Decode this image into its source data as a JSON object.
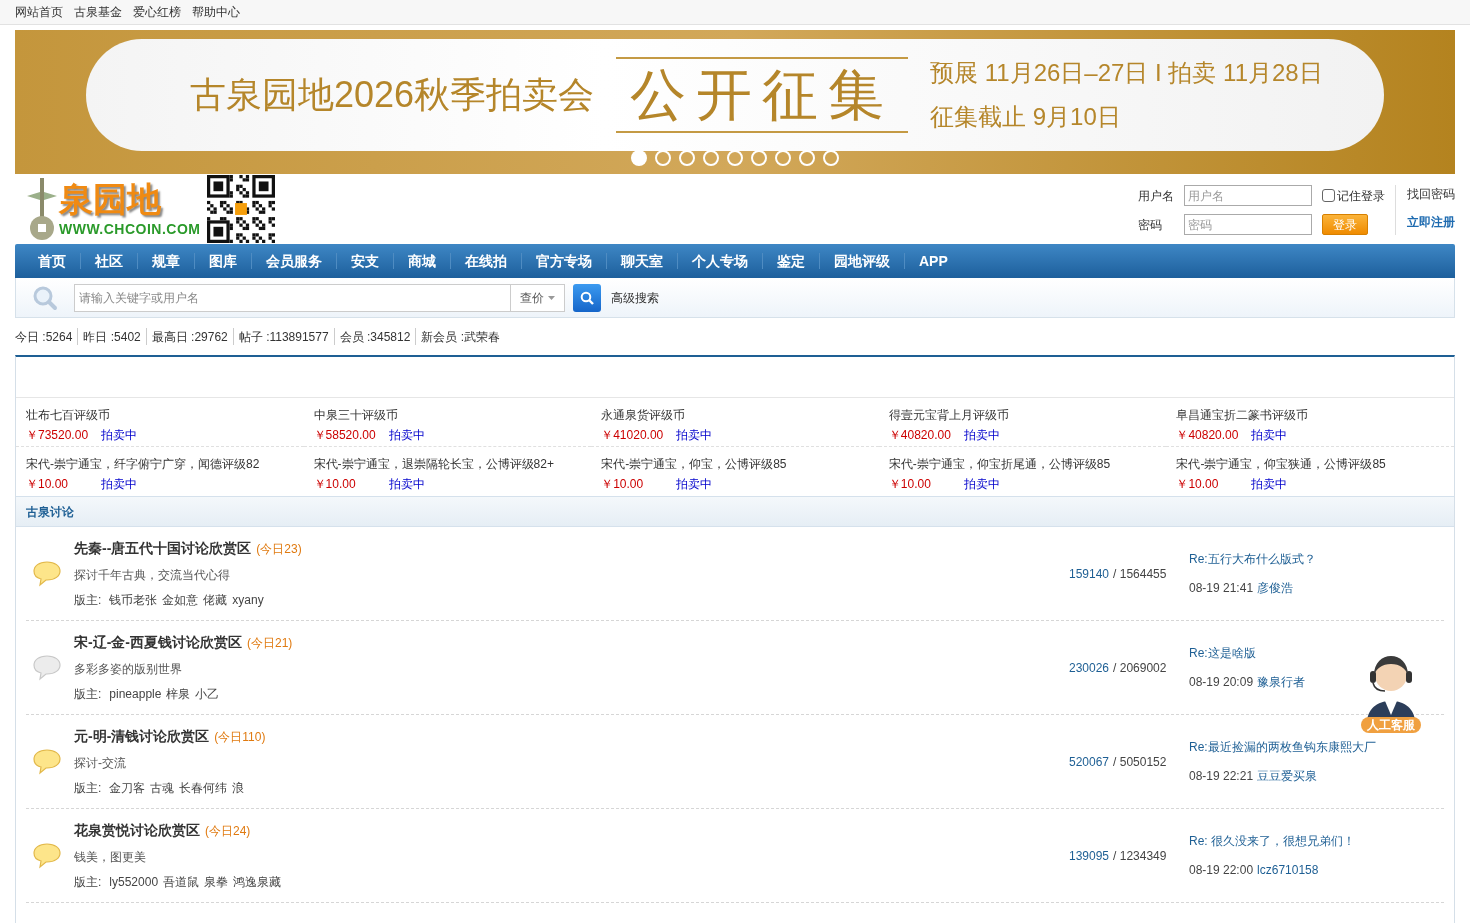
{
  "top_links": [
    "网站首页",
    "古泉基金",
    "爱心红榜",
    "帮助中心"
  ],
  "banner": {
    "title": "古泉园地2026秋季拍卖会",
    "headline": "公开征集",
    "schedule": "预展 11月26日–27日 I 拍卖 11月28日",
    "deadline": "征集截止 9月10日",
    "slides": [
      {
        "selected": true
      },
      {
        "selected": false
      },
      {
        "selected": false
      },
      {
        "selected": false
      },
      {
        "selected": false
      },
      {
        "selected": false
      },
      {
        "selected": false
      },
      {
        "selected": false
      },
      {
        "selected": false
      }
    ]
  },
  "logo": {
    "name": "泉园地",
    "url": "WWW.CHCOIN.COM"
  },
  "login": {
    "username_label": "用户名",
    "username_placeholder": "用户名",
    "remember_label": "记住登录",
    "remember": false,
    "password_label": "密码",
    "password_placeholder": "密码",
    "login_button": "登录",
    "forgot": "找回密码",
    "register": "立即注册"
  },
  "nav": [
    "首页",
    "社区",
    "规章",
    "图库",
    "会员服务",
    "安支",
    "商城",
    "在线拍",
    "官方专场",
    "聊天室",
    "个人专场",
    "鉴定",
    "园地评级",
    "APP"
  ],
  "search": {
    "placeholder": "请输入关键字或用户名",
    "type": "查价",
    "advanced": "高级搜索"
  },
  "stats": [
    "今日 :5264",
    "昨日 :5402",
    "最高日 :29762",
    "帖子 :113891577",
    "会员 :345812",
    "新会员 :武荣春"
  ],
  "auctions": [
    {
      "name": "壮布七百评级币",
      "price": "￥73520.00",
      "status": "拍卖中"
    },
    {
      "name": "中泉三十评级币",
      "price": "￥58520.00",
      "status": "拍卖中"
    },
    {
      "name": "永通泉货评级币",
      "price": "￥41020.00",
      "status": "拍卖中"
    },
    {
      "name": "得壹元宝背上月评级币",
      "price": "￥40820.00",
      "status": "拍卖中"
    },
    {
      "name": "阜昌通宝折二篆书评级币",
      "price": "￥40820.00",
      "status": "拍卖中"
    },
    {
      "name": "宋代-崇宁通宝，纤字俯宁广穿，闻德评级82",
      "price": "￥10.00",
      "status": "拍卖中"
    },
    {
      "name": "宋代-崇宁通宝，退崇隔轮长宝，公博评级82+",
      "price": "￥10.00",
      "status": "拍卖中"
    },
    {
      "name": "宋代-崇宁通宝，仰宝，公博评级85",
      "price": "￥10.00",
      "status": "拍卖中"
    },
    {
      "name": "宋代-崇宁通宝，仰宝折尾通，公博评级85",
      "price": "￥10.00",
      "status": "拍卖中"
    },
    {
      "name": "宋代-崇宁通宝，仰宝狭通，公博评级85",
      "price": "￥10.00",
      "status": "拍卖中"
    }
  ],
  "section_title": "古泉讨论",
  "forums": [
    {
      "title": "先秦--唐五代十国讨论欣赏区",
      "today": "(今日23)",
      "description": "探讨千年古典，交流当代心得",
      "moderators_label": "版主:",
      "moderators": [
        "钱币老张",
        "金如意",
        "佬藏",
        "xyany"
      ],
      "new_posts": true,
      "topics": "159140",
      "posts": "/ 1564455",
      "last_title": "Re:五行大布什么版式？",
      "last_time": "08-19 21:41",
      "last_user": "彦俊浩"
    },
    {
      "title": "宋-辽-金-西夏钱讨论欣赏区",
      "today": "(今日21)",
      "description": "多彩多姿的版别世界",
      "moderators_label": "版主:",
      "moderators": [
        "pineapple",
        "梓泉",
        "小乙"
      ],
      "new_posts": false,
      "topics": "230026",
      "posts": "/ 2069002",
      "last_title": "Re:这是啥版",
      "last_time": "08-19 20:09",
      "last_user": "豫泉行者"
    },
    {
      "title": "元-明-清钱讨论欣赏区",
      "today": "(今日110)",
      "description": "探讨-交流",
      "moderators_label": "版主:",
      "moderators": [
        "金刀客",
        "古魂",
        "长春何纬",
        "浪"
      ],
      "new_posts": true,
      "topics": "520067",
      "posts": "/ 5050152",
      "last_title": "Re:最近捡漏的两枚鱼钩东康熙大厂",
      "last_time": "08-19 22:21",
      "last_user": "豆豆爱买泉"
    },
    {
      "title": "花泉赏悦讨论欣赏区",
      "today": "(今日24)",
      "description": "钱美，图更美",
      "moderators_label": "版主:",
      "moderators": [
        "ly552000",
        "吾道鼠",
        "泉拳",
        "鸿逸泉藏"
      ],
      "new_posts": true,
      "topics": "139095",
      "posts": "/ 1234349",
      "last_title": "Re:  很久没来了，很想兄弟们！",
      "last_time": "08-19 22:00",
      "last_user": "lcz6710158"
    }
  ],
  "support_badge": "人工客服"
}
